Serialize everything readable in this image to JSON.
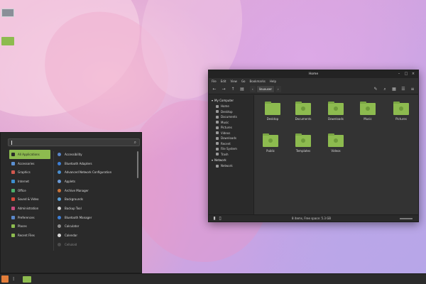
{
  "file_manager": {
    "title": "Home",
    "window_buttons": [
      "–",
      "□",
      "×"
    ],
    "menu": [
      "File",
      "Edit",
      "View",
      "Go",
      "Bookmarks",
      "Help"
    ],
    "toolbar_icons": [
      "back-icon",
      "forward-icon",
      "up-icon",
      "location-icon"
    ],
    "breadcrumb": [
      "‹",
      "linuxuser",
      "›"
    ],
    "sidebar": {
      "computer_heading": "My Computer",
      "places": [
        "Home",
        "Desktop",
        "Documents",
        "Music",
        "Pictures",
        "Videos",
        "Downloads",
        "Recent",
        "File System",
        "Trash"
      ],
      "network_heading": "Network",
      "network_items": [
        "Network"
      ]
    },
    "folders": [
      "Desktop",
      "Documents",
      "Downloads",
      "Music",
      "Pictures",
      "Public",
      "Templates",
      "Videos"
    ],
    "status": "8 items, Free space: 5.3 GB"
  },
  "menu": {
    "search_value": "",
    "categories": [
      "All Applications",
      "Accessories",
      "Graphics",
      "Internet",
      "Office",
      "Sound & Video",
      "Administration",
      "Preferences",
      "Places",
      "Recent Files"
    ],
    "active_category": 0,
    "apps": [
      "Accessibility",
      "Bluetooth Adapters",
      "Advanced Network Configuration",
      "Applets",
      "Archive Manager",
      "Backgrounds",
      "Backup Tool",
      "Bluetooth Manager",
      "Calculator",
      "Calendar",
      "Celluloid"
    ]
  },
  "colors": {
    "accent": "#8dbb4f",
    "window_bg": "#2b2b2b",
    "content_bg": "#333333"
  }
}
